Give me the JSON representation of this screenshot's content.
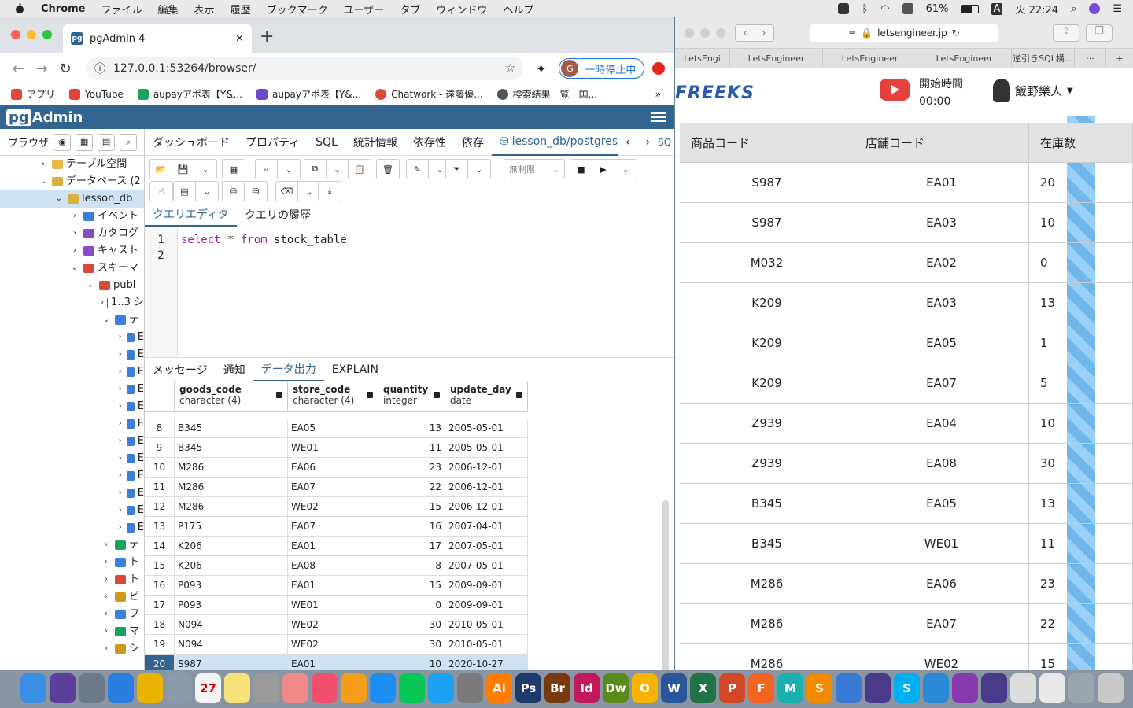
{
  "menubar": {
    "app": "Chrome",
    "items": [
      "ファイル",
      "編集",
      "表示",
      "履歴",
      "ブックマーク",
      "ユーザー",
      "タブ",
      "ウィンドウ",
      "ヘルプ"
    ],
    "battery": "61%",
    "input": "A",
    "clock": "火 22:24"
  },
  "chrome": {
    "tab_title": "pgAdmin 4",
    "url": "127.0.0.1:53264/browser/",
    "profile_initial": "G",
    "pause_label": "一時停止中",
    "bookmarks": [
      {
        "label": "アプリ",
        "color": "#e0483e"
      },
      {
        "label": "YouTube",
        "color": "#e4433c"
      },
      {
        "label": "aupayアポ表【Y&...",
        "color": "#1aa260"
      },
      {
        "label": "aupayアポ表【Y&...",
        "color": "#7048c8"
      },
      {
        "label": "Chatwork - 遠藤優...",
        "color": "#d94a3a"
      },
      {
        "label": "検索結果一覧｜国...",
        "color": "#555555"
      }
    ]
  },
  "pgadmin": {
    "logo_pg": "pg",
    "logo_rest": "Admin",
    "browser_label": "ブラウザ",
    "tree": [
      {
        "indent": 48,
        "car": "›",
        "label": "テーブル空間",
        "color": "#e8b84a"
      },
      {
        "indent": 48,
        "car": "⌄",
        "label": "データベース (2",
        "color": "#d9b040"
      },
      {
        "indent": 68,
        "car": "⌄",
        "label": "lesson_db",
        "color": "#d9b040",
        "selected": true
      },
      {
        "indent": 88,
        "car": "›",
        "label": "イベント",
        "color": "#3b7dd8"
      },
      {
        "indent": 88,
        "car": "›",
        "label": "カタログ",
        "color": "#8a4bc8"
      },
      {
        "indent": 88,
        "car": "›",
        "label": "キャスト",
        "color": "#8a4bc8"
      },
      {
        "indent": 88,
        "car": "⌄",
        "label": "スキーマ",
        "color": "#d94a3a"
      },
      {
        "indent": 108,
        "car": "⌄",
        "label": "publ",
        "color": "#d94a3a"
      },
      {
        "indent": 128,
        "car": "›",
        "label": "1..3 シ",
        "color": "#7b3fb8"
      },
      {
        "indent": 128,
        "car": "⌄",
        "label": "テ",
        "color": "#3b7dd8"
      },
      {
        "indent": 148,
        "car": "›",
        "label": "E",
        "color": "#3b7dd8"
      },
      {
        "indent": 148,
        "car": "›",
        "label": "E",
        "color": "#3b7dd8"
      },
      {
        "indent": 148,
        "car": "›",
        "label": "E",
        "color": "#3b7dd8"
      },
      {
        "indent": 148,
        "car": "›",
        "label": "E",
        "color": "#3b7dd8"
      },
      {
        "indent": 148,
        "car": "›",
        "label": "E",
        "color": "#3b7dd8"
      },
      {
        "indent": 148,
        "car": "›",
        "label": "E",
        "color": "#3b7dd8"
      },
      {
        "indent": 148,
        "car": "›",
        "label": "E",
        "color": "#3b7dd8"
      },
      {
        "indent": 148,
        "car": "›",
        "label": "E",
        "color": "#3b7dd8"
      },
      {
        "indent": 148,
        "car": "›",
        "label": "E",
        "color": "#3b7dd8"
      },
      {
        "indent": 148,
        "car": "›",
        "label": "E",
        "color": "#3b7dd8"
      },
      {
        "indent": 148,
        "car": "›",
        "label": "E",
        "color": "#3b7dd8"
      },
      {
        "indent": 148,
        "car": "›",
        "label": "E",
        "color": "#3b7dd8"
      },
      {
        "indent": 128,
        "car": "›",
        "label": "テ",
        "color": "#1aa260"
      },
      {
        "indent": 128,
        "car": "›",
        "label": "ト",
        "color": "#3b7dd8"
      },
      {
        "indent": 128,
        "car": "›",
        "label": "ト",
        "color": "#d94a3a"
      },
      {
        "indent": 128,
        "car": "›",
        "label": "ビ",
        "color": "#c89b1a"
      },
      {
        "indent": 128,
        "car": "›",
        "label": "フ",
        "color": "#3b7dd8"
      },
      {
        "indent": 128,
        "car": "›",
        "label": "マ",
        "color": "#1aa260"
      },
      {
        "indent": 128,
        "car": "›",
        "label": "シ",
        "color": "#c89b1a"
      }
    ],
    "tabs": [
      "ダッシュボード",
      "プロパティ",
      "SQL",
      "統計情報",
      "依存性",
      "依存"
    ],
    "active_tab": "lesson_db/postgres",
    "tab_tail": "SQL",
    "limit_label": "無制限",
    "editor_tabs": [
      "クエリエディタ",
      "クエリの履歴"
    ],
    "code": {
      "line1": "1",
      "line2": "2",
      "kw1": "select",
      "mid": " * ",
      "kw2": "from",
      "rest": " stock_table"
    },
    "output_tabs": [
      "メッセージ",
      "通知",
      "データ出力",
      "EXPLAIN"
    ],
    "columns": [
      {
        "name": "goods_code",
        "type": "character (4)"
      },
      {
        "name": "store_code",
        "type": "character (4)"
      },
      {
        "name": "quantity",
        "type": "integer"
      },
      {
        "name": "update_day",
        "type": "date"
      }
    ],
    "rows": [
      [
        "8",
        "B345",
        "EA05",
        "13",
        "2005-05-01"
      ],
      [
        "9",
        "B345",
        "WE01",
        "11",
        "2005-05-01"
      ],
      [
        "10",
        "M286",
        "EA06",
        "23",
        "2006-12-01"
      ],
      [
        "11",
        "M286",
        "EA07",
        "22",
        "2006-12-01"
      ],
      [
        "12",
        "M286",
        "WE02",
        "15",
        "2006-12-01"
      ],
      [
        "13",
        "P175",
        "EA07",
        "16",
        "2007-04-01"
      ],
      [
        "14",
        "K206",
        "EA01",
        "17",
        "2007-05-01"
      ],
      [
        "15",
        "K206",
        "EA08",
        "8",
        "2007-05-01"
      ],
      [
        "16",
        "P093",
        "EA01",
        "15",
        "2009-09-01"
      ],
      [
        "17",
        "P093",
        "WE01",
        "0",
        "2009-09-01"
      ],
      [
        "18",
        "N094",
        "WE02",
        "30",
        "2010-05-01"
      ],
      [
        "19",
        "N094",
        "WE02",
        "30",
        "2010-05-01"
      ],
      [
        "20",
        "S987",
        "EA01",
        "10",
        "2020-10-27"
      ]
    ]
  },
  "safari": {
    "url": "letsengineer.jp",
    "tabs": [
      "LetsEngi",
      "LetsEngineer",
      "LetsEngineer",
      "LetsEngineer",
      "逆引きSQL構…",
      "···"
    ],
    "logo": "FREEKS",
    "start_label": "開始時間",
    "start_time": "00:00",
    "user": "飯野樂人",
    "headers": [
      "商品コード",
      "店舗コード",
      "在庫数"
    ],
    "rows": [
      [
        "S987",
        "EA01",
        "20"
      ],
      [
        "S987",
        "EA03",
        "10"
      ],
      [
        "M032",
        "EA02",
        "0"
      ],
      [
        "K209",
        "EA03",
        "13"
      ],
      [
        "K209",
        "EA05",
        "1"
      ],
      [
        "K209",
        "EA07",
        "5"
      ],
      [
        "Z939",
        "EA04",
        "10"
      ],
      [
        "Z939",
        "EA08",
        "30"
      ],
      [
        "B345",
        "EA05",
        "13"
      ],
      [
        "B345",
        "WE01",
        "11"
      ],
      [
        "M286",
        "EA06",
        "23"
      ],
      [
        "M286",
        "EA07",
        "22"
      ],
      [
        "M286",
        "WE02",
        "15"
      ]
    ]
  },
  "dock": [
    {
      "label": "",
      "color": "#3a8ee6"
    },
    {
      "label": "",
      "color": "#5a3f9a"
    },
    {
      "label": "",
      "color": "#6c7a89"
    },
    {
      "label": "",
      "color": "#2a7de1"
    },
    {
      "label": "",
      "color": "#e8b400"
    },
    {
      "label": "",
      "color": "#8b9aa8"
    },
    {
      "label": "27",
      "color": "#f4f4f4"
    },
    {
      "label": "",
      "color": "#f7e27a"
    },
    {
      "label": "",
      "color": "#9a9a9a"
    },
    {
      "label": "",
      "color": "#f08a8a"
    },
    {
      "label": "",
      "color": "#f0506e"
    },
    {
      "label": "",
      "color": "#f59e1b"
    },
    {
      "label": "",
      "color": "#1c8ef0"
    },
    {
      "label": "",
      "color": "#06c755"
    },
    {
      "label": "",
      "color": "#1da1f2"
    },
    {
      "label": "",
      "color": "#7a7a7a"
    },
    {
      "label": "Ai",
      "color": "#ff7c00"
    },
    {
      "label": "Ps",
      "color": "#1d3a6a"
    },
    {
      "label": "Br",
      "color": "#7a3a10"
    },
    {
      "label": "Id",
      "color": "#c01a5a"
    },
    {
      "label": "Dw",
      "color": "#5a8a1a"
    },
    {
      "label": "O",
      "color": "#f4b400"
    },
    {
      "label": "W",
      "color": "#2b579a"
    },
    {
      "label": "X",
      "color": "#217346"
    },
    {
      "label": "P",
      "color": "#d24726"
    },
    {
      "label": "F",
      "color": "#f26522"
    },
    {
      "label": "M",
      "color": "#1ab0b0"
    },
    {
      "label": "S",
      "color": "#f08a00"
    },
    {
      "label": "",
      "color": "#3a7bd5"
    },
    {
      "label": "",
      "color": "#4a3a8a"
    },
    {
      "label": "S",
      "color": "#00aff0"
    },
    {
      "label": "",
      "color": "#2a8ad8"
    },
    {
      "label": "",
      "color": "#8a3ab0"
    },
    {
      "label": "",
      "color": "#4a3a8a"
    },
    {
      "label": "",
      "color": "#dcdcdc"
    },
    {
      "label": "",
      "color": "#e8e8e8"
    },
    {
      "label": "",
      "color": "#9aa5b0"
    },
    {
      "label": "",
      "color": "#c8c8c8"
    }
  ]
}
